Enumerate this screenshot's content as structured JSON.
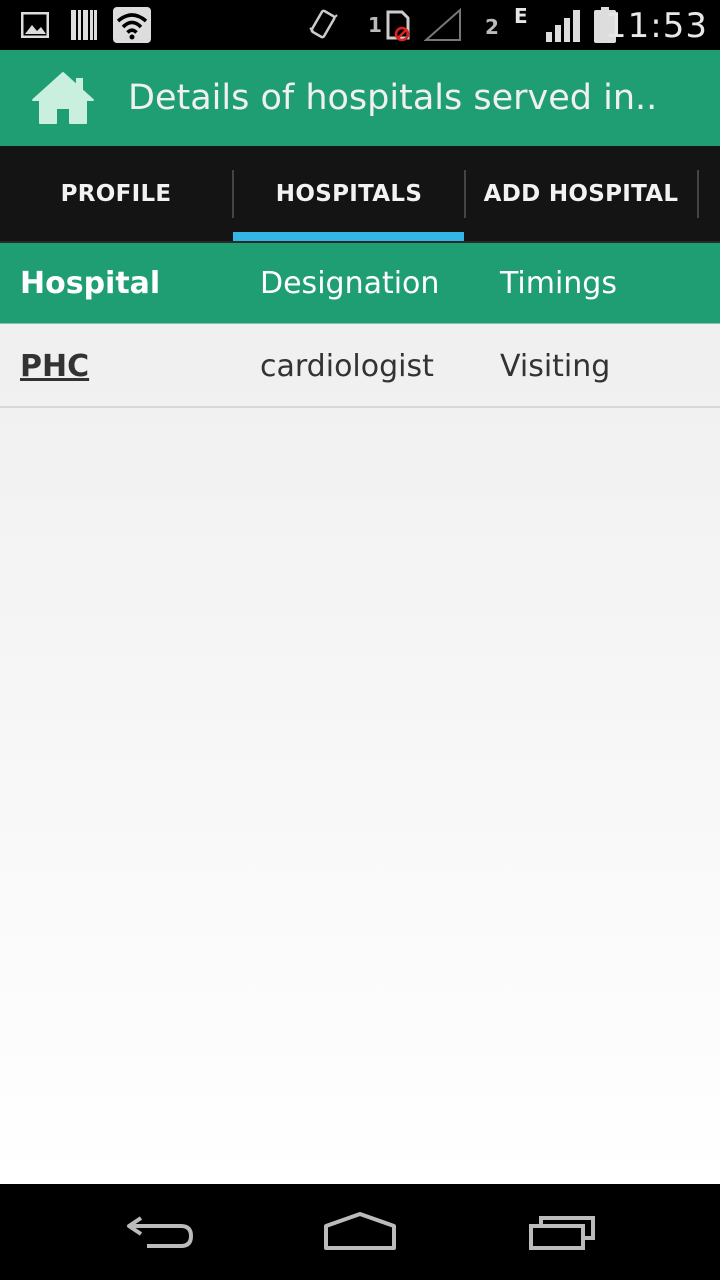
{
  "status_bar": {
    "time": "11:53",
    "sim1_label": "1",
    "sim2_label": "2",
    "network_type": "E",
    "icons": [
      "image-icon",
      "barcode-icon",
      "wifi-icon",
      "vibrate-icon",
      "sim-blocked-icon",
      "signal-empty-icon",
      "signal-icon",
      "battery-icon"
    ]
  },
  "action_bar": {
    "icon": "home-icon",
    "title": "Details of hospitals served in.."
  },
  "tabs": [
    {
      "label": "PROFILE",
      "selected": false
    },
    {
      "label": "HOSPITALS",
      "selected": true
    },
    {
      "label": "ADD HOSPITAL",
      "selected": false
    }
  ],
  "table": {
    "headers": [
      "Hospital",
      "Designation",
      "Timings"
    ],
    "rows": [
      [
        "PHC",
        "cardiologist",
        "Visiting"
      ]
    ]
  },
  "nav_bar": {
    "icons": [
      "back-icon",
      "home-nav-icon",
      "recents-icon"
    ]
  },
  "colors": {
    "accent": "#1f9e74",
    "tab_indicator": "#33b5e5",
    "tab_background": "#141414"
  }
}
